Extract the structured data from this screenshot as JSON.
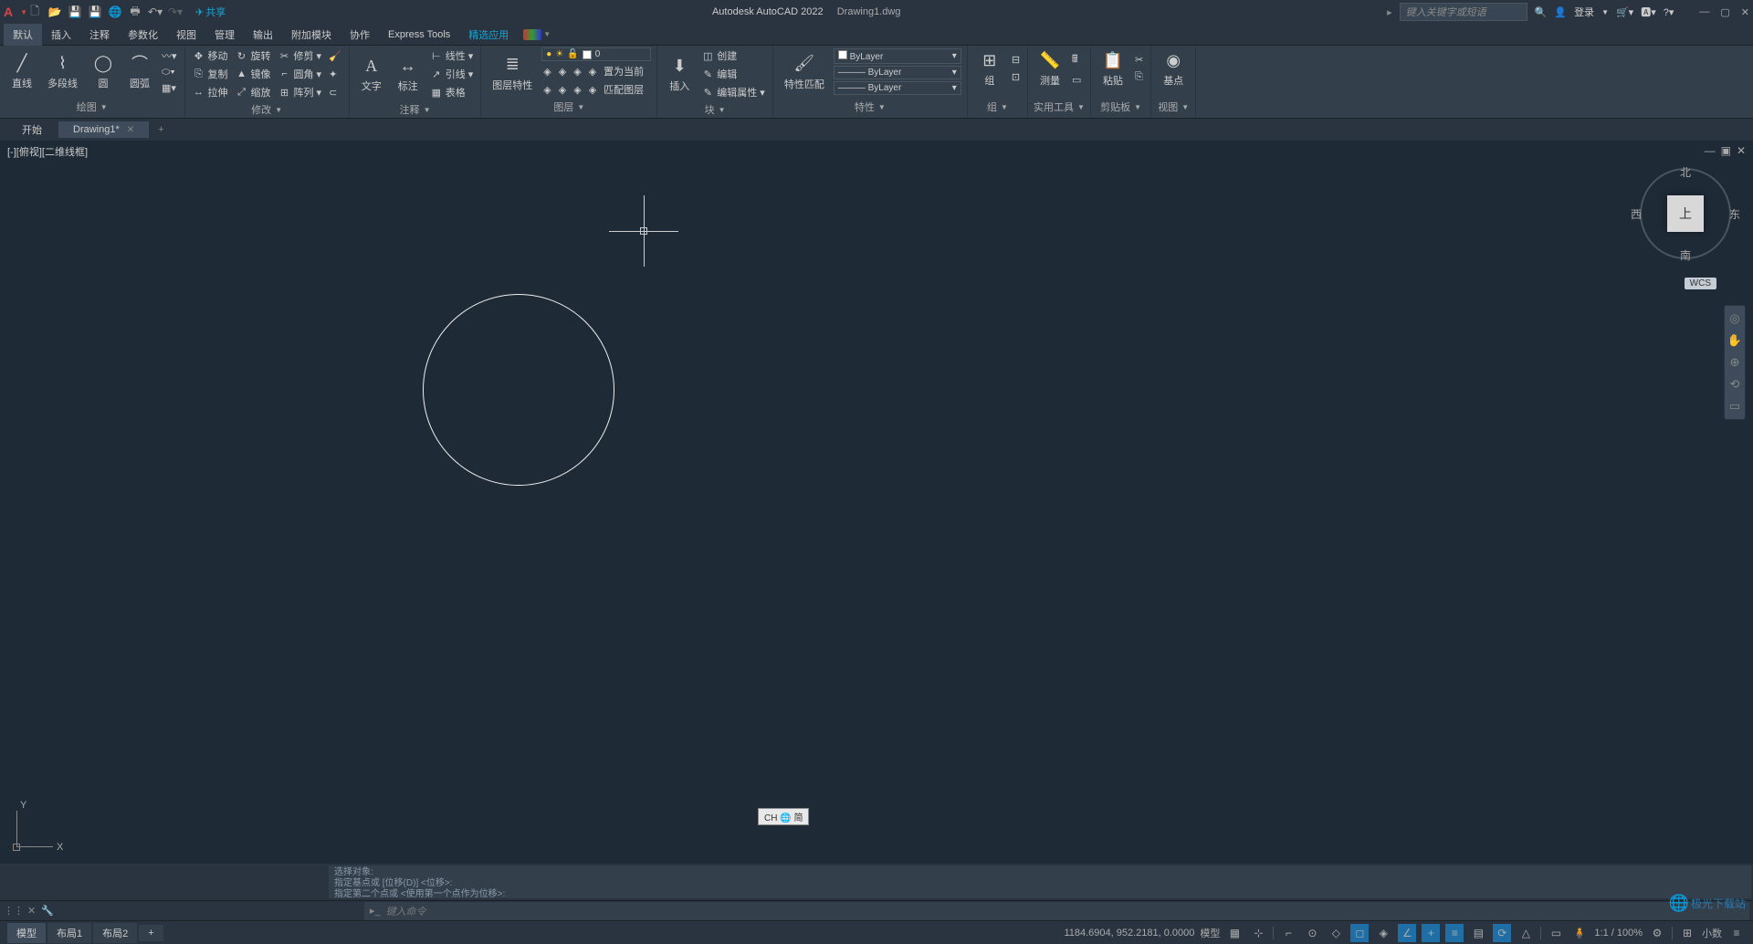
{
  "titlebar": {
    "share": "共享",
    "appname": "Autodesk AutoCAD 2022",
    "docname": "Drawing1.dwg",
    "search_placeholder": "键入关键字或短语",
    "login": "登录"
  },
  "menus": [
    "默认",
    "插入",
    "注释",
    "参数化",
    "视图",
    "管理",
    "输出",
    "附加模块",
    "协作",
    "Express Tools",
    "精选应用"
  ],
  "ribbon": {
    "draw": {
      "line": "直线",
      "polyline": "多段线",
      "circle": "圆",
      "arc": "圆弧",
      "label": "绘图"
    },
    "modify": {
      "move": "移动",
      "rotate": "旋转",
      "trim": "修剪",
      "copy": "复制",
      "mirror": "镜像",
      "fillet": "圆角",
      "stretch": "拉伸",
      "scale": "缩放",
      "array": "阵列",
      "label": "修改"
    },
    "annotate": {
      "text": "文字",
      "dim": "标注",
      "linetype": "线性",
      "leader": "引线",
      "table": "表格",
      "label": "注释"
    },
    "layers": {
      "props": "图层特性",
      "current": "0",
      "set_current": "置为当前",
      "match": "匹配图层",
      "label": "图层"
    },
    "block": {
      "insert": "插入",
      "create": "创建",
      "edit": "编辑",
      "editattr": "编辑属性",
      "label": "块"
    },
    "props": {
      "match": "特性匹配",
      "bylayer": "ByLayer",
      "label": "特性"
    },
    "group": {
      "group": "组",
      "label": "组"
    },
    "utils": {
      "measure": "测量",
      "label": "实用工具"
    },
    "clip": {
      "paste": "粘贴",
      "label": "剪贴板"
    },
    "view": {
      "base": "基点",
      "label": "视图"
    }
  },
  "tabs": {
    "start": "开始",
    "drawing": "Drawing1*"
  },
  "viewport": {
    "label": "[-][俯视][二维线框]",
    "wcs": "WCS",
    "top": "上",
    "n": "北",
    "s": "南",
    "e": "东",
    "w": "西",
    "y": "Y",
    "x": "X"
  },
  "cmd": {
    "hist1": "选择对象:",
    "hist2": "指定基点或 [位移(D)] <位移>:",
    "hist3": "指定第二个点或 <使用第一个点作为位移>:",
    "prompt": "键入命令",
    "ime": "CH 🌐 简"
  },
  "status": {
    "model": "模型",
    "layout1": "布局1",
    "layout2": "布局2",
    "coords": "1184.6904, 952.2181, 0.0000",
    "model_btn": "模型",
    "scale": "1:1 / 100%",
    "decimal": "小数"
  },
  "watermark": "极光下载站"
}
